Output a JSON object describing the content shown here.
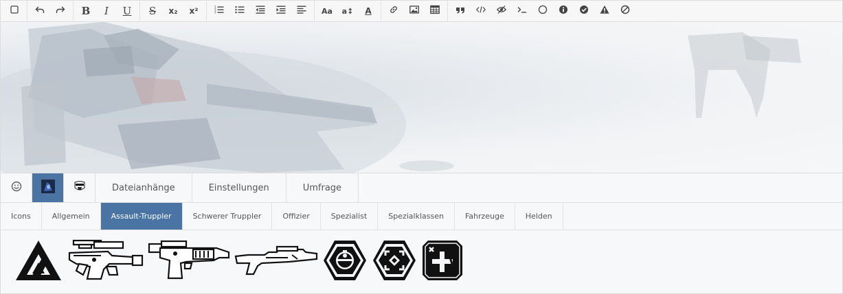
{
  "toolbar": {
    "groups": [
      [
        {
          "name": "source-toggle-icon"
        }
      ],
      [
        {
          "name": "undo-icon"
        },
        {
          "name": "redo-icon"
        }
      ],
      [
        {
          "name": "bold-icon",
          "text": "B"
        },
        {
          "name": "italic-icon",
          "text": "I"
        },
        {
          "name": "underline-icon",
          "text": "U"
        }
      ],
      [
        {
          "name": "strikethrough-icon",
          "text": "S"
        },
        {
          "name": "subscript-icon",
          "text": "x₂"
        },
        {
          "name": "superscript-icon",
          "text": "x²"
        }
      ],
      [
        {
          "name": "ordered-list-icon"
        },
        {
          "name": "unordered-list-icon"
        },
        {
          "name": "outdent-icon"
        },
        {
          "name": "indent-icon"
        },
        {
          "name": "align-icon"
        }
      ],
      [
        {
          "name": "font-size-icon",
          "text": "Aa"
        },
        {
          "name": "line-height-icon",
          "text": "a↕"
        },
        {
          "name": "font-color-icon",
          "text": "A"
        }
      ],
      [
        {
          "name": "link-icon"
        },
        {
          "name": "image-icon"
        },
        {
          "name": "table-icon"
        }
      ],
      [
        {
          "name": "quote-icon"
        },
        {
          "name": "code-icon"
        },
        {
          "name": "spoiler-icon"
        },
        {
          "name": "terminal-icon"
        },
        {
          "name": "circle-icon"
        },
        {
          "name": "info-icon"
        },
        {
          "name": "check-icon"
        },
        {
          "name": "warning-icon"
        },
        {
          "name": "ban-icon"
        }
      ]
    ]
  },
  "tabs": {
    "primary": [
      {
        "name": "smiley-tab",
        "icon": "smiley-icon"
      },
      {
        "name": "avatar-tab-1",
        "icon": "avatar-icon-1",
        "active": true
      },
      {
        "name": "avatar-tab-2",
        "icon": "avatar-icon-2"
      },
      {
        "name": "tab-attachments",
        "label": "Dateianhänge"
      },
      {
        "name": "tab-settings",
        "label": "Einstellungen"
      },
      {
        "name": "tab-poll",
        "label": "Umfrage"
      }
    ],
    "secondary": [
      {
        "label": "Icons"
      },
      {
        "label": "Allgemein"
      },
      {
        "label": "Assault-Truppler",
        "active": true
      },
      {
        "label": "Schwerer Truppler"
      },
      {
        "label": "Offizier"
      },
      {
        "label": "Spezialist"
      },
      {
        "label": "Spezialklassen"
      },
      {
        "label": "Fahrzeuge"
      },
      {
        "label": "Helden"
      }
    ]
  },
  "emoticons": [
    {
      "name": "assault-class-icon"
    },
    {
      "name": "blaster-rifle-icon-1"
    },
    {
      "name": "blaster-rifle-icon-2"
    },
    {
      "name": "blaster-rifle-icon-3"
    },
    {
      "name": "droid-hexagon-icon"
    },
    {
      "name": "target-hexagon-icon"
    },
    {
      "name": "medic-square-icon"
    }
  ],
  "colors": {
    "accent": "#4a74a3",
    "toolbar_bg": "#f7f7f7",
    "border": "#dcdcdc"
  }
}
